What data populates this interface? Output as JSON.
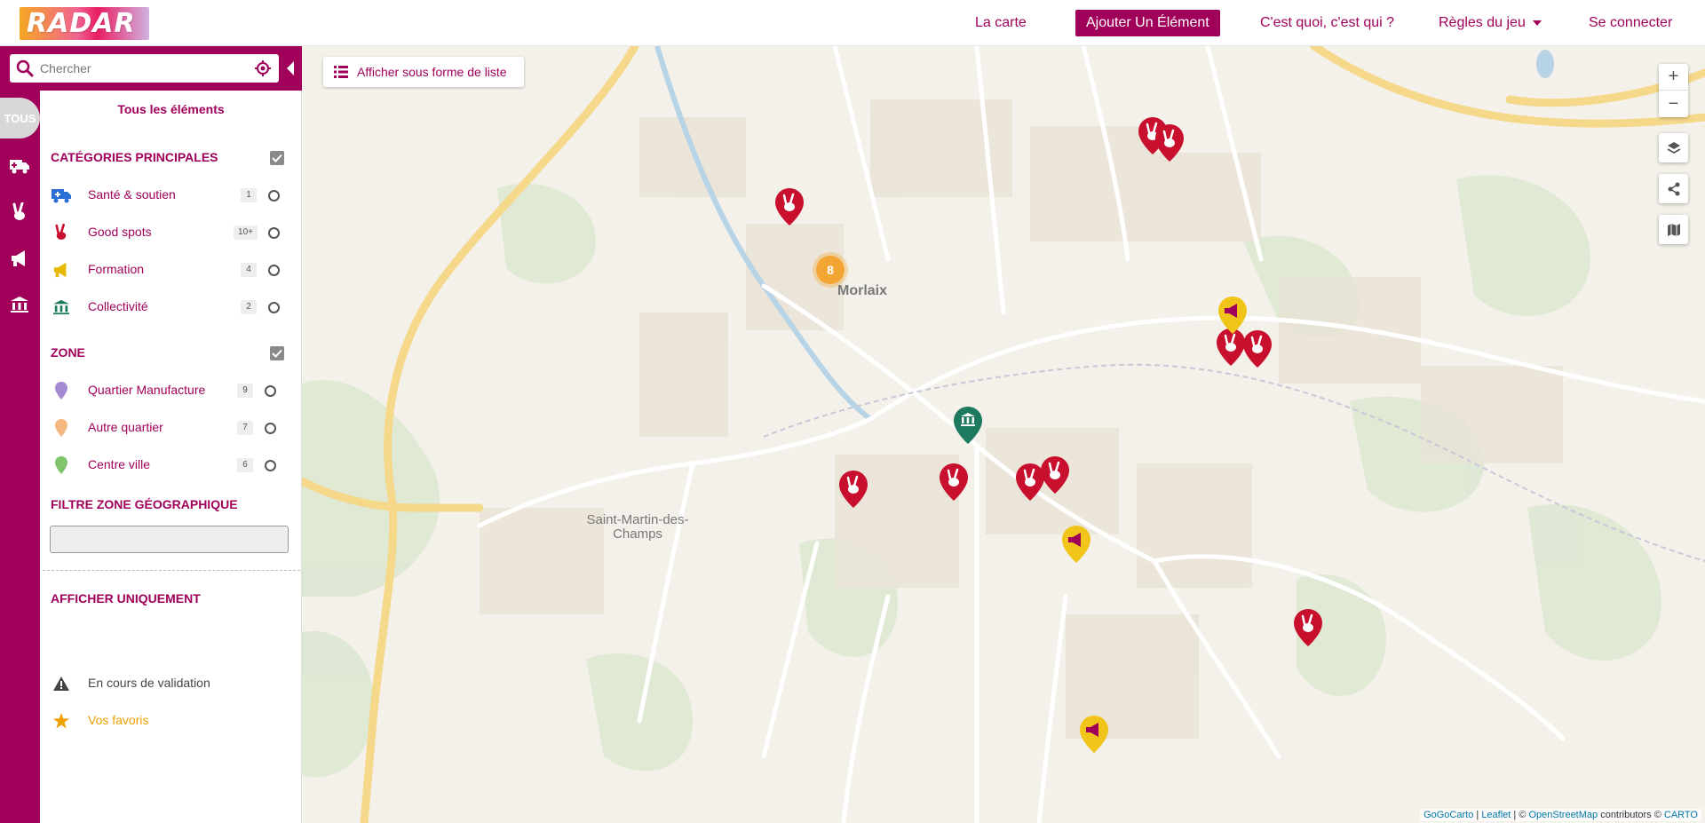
{
  "header": {
    "logo_text": "RADAR",
    "nav": {
      "map": "La carte",
      "add": "Ajouter Un Élément",
      "about": "C'est quoi, c'est qui ?",
      "rules": "Règles du jeu",
      "login": "Se connecter"
    }
  },
  "rail": {
    "all_label": "TOUS"
  },
  "search": {
    "placeholder": "Chercher"
  },
  "sidebar": {
    "title": "Tous les éléments",
    "main_categories": {
      "title": "CATÉGORIES PRINCIPALES",
      "items": [
        {
          "label": "Santé & soutien",
          "count": "1",
          "icon": "ambulance-icon",
          "color": "#2a6fd6"
        },
        {
          "label": "Good spots",
          "count": "10+",
          "icon": "peace-hand-icon",
          "color": "#c8102e"
        },
        {
          "label": "Formation",
          "count": "4",
          "icon": "megaphone-icon",
          "color": "#e6b800"
        },
        {
          "label": "Collectivité",
          "count": "2",
          "icon": "bank-icon",
          "color": "#1e7a5e"
        }
      ]
    },
    "zone": {
      "title": "ZONE",
      "items": [
        {
          "label": "Quartier Manufacture",
          "count": "9",
          "color": "#a48bd1"
        },
        {
          "label": "Autre quartier",
          "count": "7",
          "color": "#f5b880"
        },
        {
          "label": "Centre ville",
          "count": "6",
          "color": "#7fc46a"
        }
      ]
    },
    "geo_filter": {
      "title": "FILTRE ZONE GÉOGRAPHIQUE",
      "value": ""
    },
    "only": {
      "title": "AFFICHER UNIQUEMENT",
      "items": [
        {
          "label": "En cours de validation",
          "icon": "warning-icon",
          "color": "#444"
        },
        {
          "label": "Vos favoris",
          "icon": "star-icon",
          "color": "#f0a000"
        }
      ]
    }
  },
  "map": {
    "list_button": "Afficher sous forme de liste",
    "places": [
      "Morlaix",
      "Saint-Martin-des-Champs"
    ],
    "cluster_count": "8",
    "attribution": {
      "gogocarto": "GoGoCarto",
      "sep1": " | ",
      "leaflet": "Leaflet",
      "sep2": " | © ",
      "osm": "OpenStreetMap",
      "sep3": " contributors © ",
      "carto": "CARTO"
    }
  },
  "colors": {
    "brand": "#a0005a",
    "goodspot": "#c8102e",
    "formation": "#f0c419",
    "collectivite": "#1e7a5e",
    "cluster": "#f3a634"
  }
}
